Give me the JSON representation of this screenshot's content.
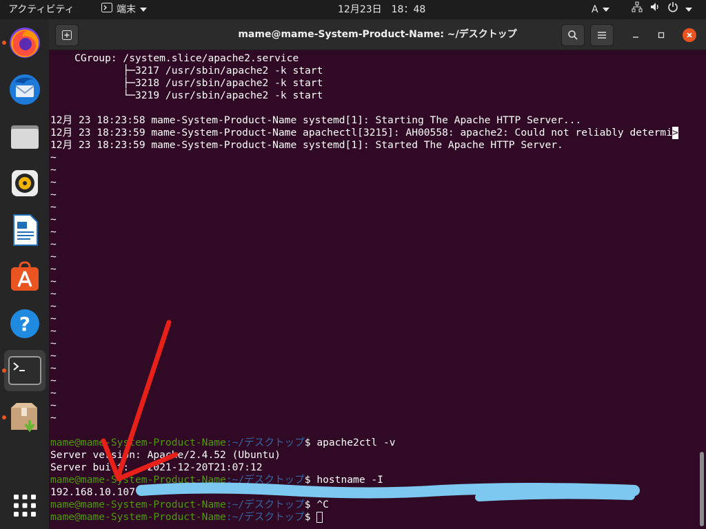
{
  "topbar": {
    "activities": "アクティビティ",
    "app_menu": "端末",
    "clock": "12月23日　18：48",
    "input_method": "A"
  },
  "dock": {
    "items": [
      "firefox",
      "thunderbird",
      "files",
      "rhythmbox",
      "libreoffice-writer",
      "ubuntu-software",
      "help",
      "terminal",
      "archive-manager",
      "show-applications"
    ]
  },
  "window": {
    "title": "mame@mame-System-Product-Name: ~/デスクトップ"
  },
  "terminal": {
    "status_lines": [
      "    CGroup: /system.slice/apache2.service",
      "            ├─3217 /usr/sbin/apache2 -k start",
      "            ├─3218 /usr/sbin/apache2 -k start",
      "            └─3219 /usr/sbin/apache2 -k start"
    ],
    "log_lines": [
      "12月 23 18:23:58 mame-System-Product-Name systemd[1]: Starting The Apache HTTP Server...",
      "12月 23 18:23:59 mame-System-Product-Name apachectl[3215]: AH00558: apache2: Could not reliably determi",
      "12月 23 18:23:59 mame-System-Product-Name systemd[1]: Started The Apache HTTP Server."
    ],
    "truncation_marker": ">",
    "tilde": "~",
    "prompt_user": "mame@mame-System-Product-Name",
    "prompt_path": ":~/デスクトップ",
    "prompt_sign": "$ ",
    "cmd1": "apache2ctl -v",
    "out_version": "Server version: Apache/2.4.52 (Ubuntu)",
    "out_built": "Server built:   2021-12-20T21:07:12",
    "cmd2": "hostname -I",
    "out_ip": "192.168.10.107",
    "cmd3": "^C"
  },
  "colors": {
    "terminal_bg": "#300a24",
    "prompt_user": "#4e9a06",
    "prompt_path": "#3465a4",
    "annotation_arrow": "#e8201a",
    "annotation_redaction": "#7dc8f0"
  }
}
